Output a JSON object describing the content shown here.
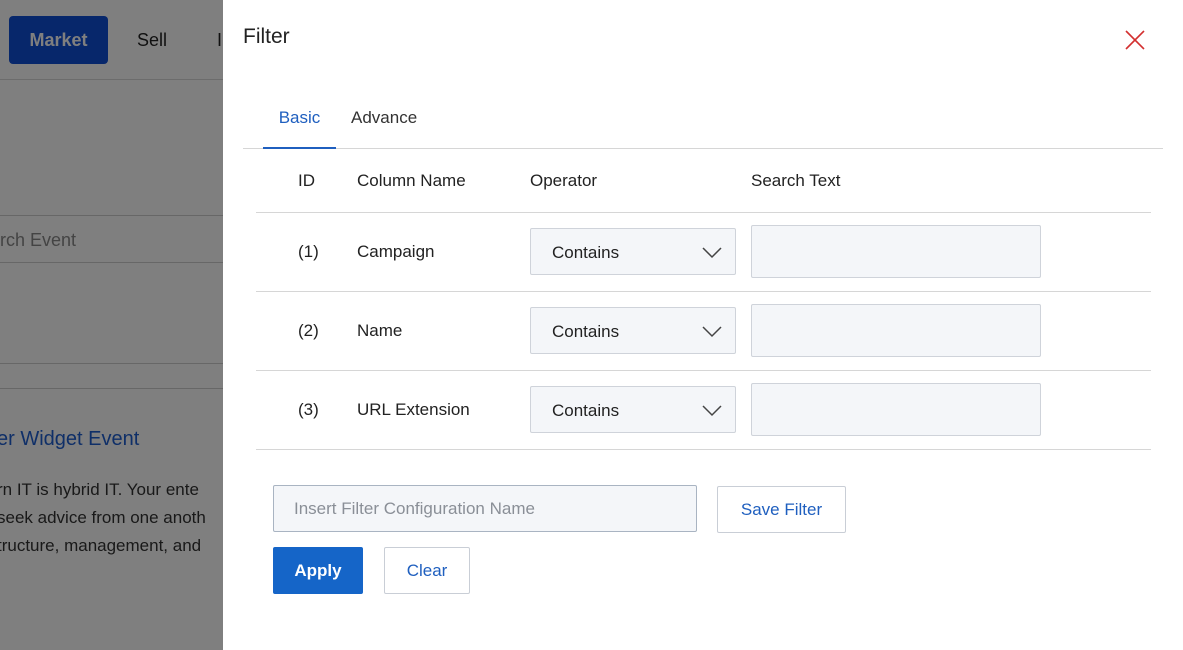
{
  "background": {
    "nav": {
      "market_label": "Market",
      "sell_label": "Sell",
      "third_label_partial": "I"
    },
    "search_placeholder_partial": "arch Event",
    "event": {
      "title_partial": "er Widget Event",
      "desc_lines_partial": [
        "rn IT is hybrid IT. Your ente",
        "seek advice from one anoth",
        "tructure, management, and"
      ]
    }
  },
  "modal": {
    "title": "Filter",
    "close_icon": "close-icon",
    "tabs": [
      {
        "label": "Basic",
        "active": true
      },
      {
        "label": "Advance",
        "active": false
      }
    ],
    "columns": {
      "id": "ID",
      "column_name": "Column Name",
      "operator": "Operator",
      "search_text": "Search Text"
    },
    "rows": [
      {
        "id": "(1)",
        "column_name": "Campaign",
        "operator": "Contains",
        "search_text": ""
      },
      {
        "id": "(2)",
        "column_name": "Name",
        "operator": "Contains",
        "search_text": ""
      },
      {
        "id": "(3)",
        "column_name": "URL Extension",
        "operator": "Contains",
        "search_text": ""
      }
    ],
    "config_name": {
      "value": "",
      "placeholder": "Insert Filter Configuration Name"
    },
    "buttons": {
      "save_filter": "Save Filter",
      "apply": "Apply",
      "clear": "Clear"
    }
  },
  "colors": {
    "accent": "#1f5fbf",
    "apply_bg": "#1565c8",
    "close_icon": "#d32f2f",
    "overlay": "rgba(0,0,0,0.5)"
  }
}
